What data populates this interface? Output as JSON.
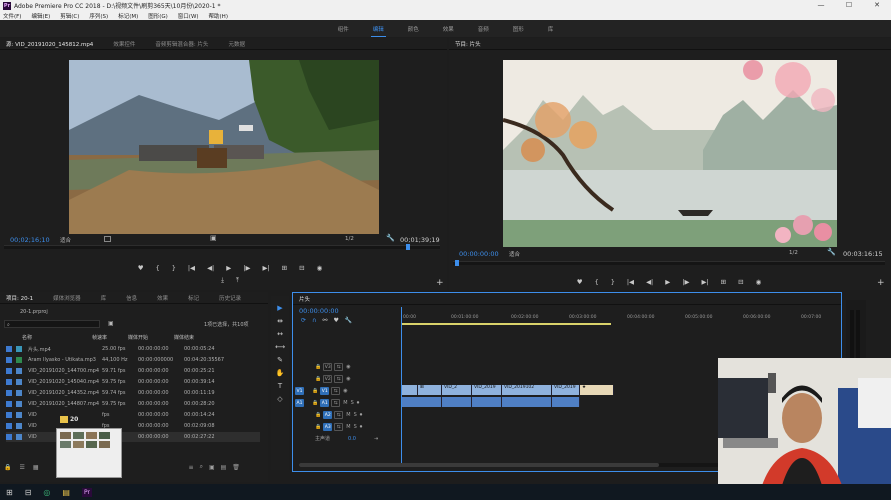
{
  "title": "Adobe Premiere Pro CC 2018 - D:\\视频文件\\刷剪365天\\10月份\\2020-1 *",
  "app_badge": "Pr",
  "menu": [
    "文件(F)",
    "编辑(E)",
    "剪辑(C)",
    "序列(S)",
    "标记(M)",
    "图形(G)",
    "窗口(W)",
    "帮助(H)"
  ],
  "workspaces": [
    "组件",
    "编辑",
    "颜色",
    "效果",
    "音频",
    "图形",
    "库"
  ],
  "active_workspace_index": 1,
  "window_controls": [
    "—",
    "☐",
    "✕"
  ],
  "source": {
    "tabs": [
      "源: VID_20191020_145812.mp4",
      "效果控件",
      "音频剪辑混合器: 片头",
      "元数据"
    ],
    "tc_left": "00;02;16;10",
    "fit": "适合",
    "fraction": "1/2",
    "tc_right": "00;01;39;19",
    "controls": [
      "♥",
      "{",
      "}",
      "|◀",
      "◀|",
      "▶",
      "|▶",
      "▶|",
      "⊞",
      "⊟",
      "◉"
    ],
    "sub_controls": [
      "⤓",
      "⤒"
    ]
  },
  "program": {
    "tabs": [
      "节目: 片头"
    ],
    "tc_left": "00:00:00:00",
    "fit": "适合",
    "fraction": "1/2",
    "tc_right": "00:03:16:15",
    "controls": [
      "♥",
      "{",
      "}",
      "|◀",
      "◀|",
      "▶",
      "|▶",
      "▶|",
      "⊞",
      "⊟",
      "◉"
    ],
    "plus": "+"
  },
  "project": {
    "tabs": [
      "项目: 20-1",
      "媒体浏览器",
      "库",
      "信息",
      "效果",
      "标记",
      "历史记录"
    ],
    "file": "20-1.prproj",
    "selection": "1项已选择，共10项",
    "headers": [
      "名称",
      "帧速率",
      "媒体开始",
      "媒体结束"
    ],
    "rows": [
      {
        "name": "片头.mp4",
        "fps": "25.00 fps",
        "start": "00:00:00:00",
        "end": "00:00:05:24",
        "color": "#3a96b8"
      },
      {
        "name": "Aram Ilyasko - Utikata.mp3",
        "fps": "44,100 Hz",
        "start": "00:00:000000",
        "end": "00:04:20:35567",
        "color": "#2f8a4f"
      },
      {
        "name": "VID_20191020_144700.mp4",
        "fps": "59.71 fps",
        "start": "00:00:00:00",
        "end": "00:00:25:21",
        "color": "#4d86c9"
      },
      {
        "name": "VID_20191020_145040.mp4",
        "fps": "59.75 fps",
        "start": "00:00:00:00",
        "end": "00:00:39:14",
        "color": "#4d86c9"
      },
      {
        "name": "VID_20191020_144352.mp4",
        "fps": "59.74 fps",
        "start": "00:00:00:00",
        "end": "00:00:11:19",
        "color": "#4d86c9"
      },
      {
        "name": "VID_20191020_144807.mp4",
        "fps": "59.75 fps",
        "start": "00:00:00:00",
        "end": "00:00:28:20",
        "color": "#4d86c9"
      },
      {
        "name": "VID",
        "fps": "fps",
        "start": "00:00:00:00",
        "end": "00:00:14:24",
        "color": "#4d86c9"
      },
      {
        "name": "VID",
        "fps": "fps",
        "start": "00:00:00:00",
        "end": "00:02:09:08",
        "color": "#4d86c9"
      },
      {
        "name": "VID",
        "fps": "fps",
        "start": "00:00:00:00",
        "end": "00:02:27:22",
        "color": "#4d86c9"
      }
    ],
    "drag_label": "20"
  },
  "timeline": {
    "tab": "片头",
    "timecode": "00:00:00:00",
    "ruler": [
      "00:00",
      "00:01:00:00",
      "00:02:00:00",
      "00:03:00:00",
      "00:04:00:00",
      "00:05:00:00",
      "00:06:00:00",
      "00:07:00"
    ],
    "video_tracks": [
      "V3",
      "V2",
      "V1"
    ],
    "audio_tracks": [
      "A1",
      "A2",
      "A3"
    ],
    "master": "主声道",
    "master_value": "0.0",
    "video_clips": [
      "",
      "VID_2",
      "VID_2019",
      "VID_2019102",
      "VID_2019",
      "",
      ""
    ],
    "audio_clips": [
      "",
      "",
      "",
      "",
      ""
    ]
  },
  "tools": [
    "▶",
    "⇹",
    "↔",
    "⟷",
    "✎",
    "✋",
    "T",
    "◇"
  ],
  "taskbar": [
    "⊞",
    "⊟",
    "◎",
    "▤",
    "Pr"
  ]
}
